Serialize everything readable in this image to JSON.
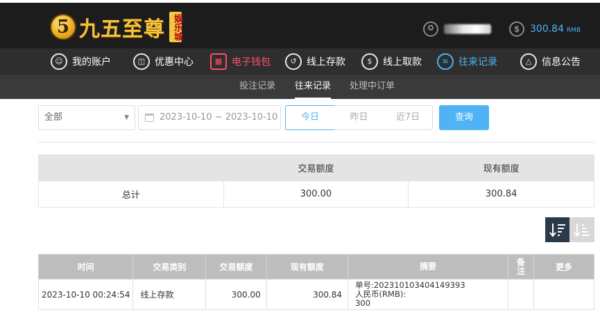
{
  "header": {
    "logo_mark": "5",
    "logo_text": "九五至尊",
    "logo_badge": "娱乐城",
    "balance": "300.84",
    "balance_unit": "RMB"
  },
  "nav": {
    "items": [
      {
        "label": "我的账户",
        "icon": "user-circle-icon"
      },
      {
        "label": "优惠中心",
        "icon": "gift-icon"
      },
      {
        "label": "电子钱包",
        "icon": "wallet-icon"
      },
      {
        "label": "线上存款",
        "icon": "deposit-icon"
      },
      {
        "label": "线上取款",
        "icon": "withdraw-icon"
      },
      {
        "label": "往来记录",
        "icon": "history-icon"
      },
      {
        "label": "信息公告",
        "icon": "bell-icon"
      }
    ]
  },
  "subnav": {
    "items": [
      {
        "label": "投注记录"
      },
      {
        "label": "往来记录"
      },
      {
        "label": "处理中订单"
      }
    ]
  },
  "filters": {
    "type_selected": "全部",
    "date_range": "2023-10-10 ~ 2023-10-10",
    "today": "今日",
    "yesterday": "昨日",
    "last7": "近7日",
    "search": "查询"
  },
  "summary": {
    "headers": [
      "",
      "交易额度",
      "现有额度"
    ],
    "row": {
      "label": "总计",
      "amount": "300.00",
      "balance": "300.84"
    }
  },
  "records": {
    "headers": [
      "时间",
      "交易类别",
      "交易额度",
      "现有额度",
      "摘要",
      "备注",
      "更多"
    ],
    "rows": [
      {
        "time": "2023-10-10 00:24:54",
        "type": "线上存款",
        "amount": "300.00",
        "balance": "300.84",
        "summary_line1": "单号:202310103404149393",
        "summary_line2": "人民币(RMB):",
        "summary_line3": "300",
        "note": "",
        "more": ""
      }
    ]
  },
  "colors": {
    "accent_blue": "#4fb3f5",
    "accent_red": "#ff4d6a",
    "header_bg": "#1c1c1c",
    "nav_bg": "#2e2e2e"
  }
}
